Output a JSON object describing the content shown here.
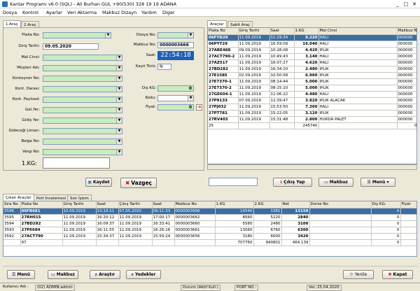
{
  "window": {
    "title": "Kantar Programı v6.0 (SQL) - Ali Burhan GUL  +90(530) 328 19 19  ADANA",
    "min": "_",
    "max": "□",
    "close": "✕"
  },
  "menu": [
    "Dosya",
    "Kontrol",
    "Ayarlar",
    "Veri Aktarma",
    "Makbuz Dizayn",
    "Yardım",
    "Diger"
  ],
  "left_tabs": [
    "1.Araç",
    "2.Araç"
  ],
  "form": {
    "plaka_label": "Plaka No:",
    "giris_tarihi_label": "Giriş Tarihi:",
    "giris_tarihi": "09.05.2020",
    "mal_cinsi_label": "Mal Cinsi:",
    "musteri_label": "Müşteri Adı:",
    "konteyner_label": "Konteyner No:",
    "kont_dara_label": "Kont. Darası:",
    "kont_payload_label": "Kont. Payload:",
    "gel_yer_label": "Gel.Yer:",
    "gidis_yer_label": "Gidiş Yer:",
    "gidecegi_liman_label": "Gideceği Liman:",
    "belge_label": "Belge No:",
    "vergi_label": "Vergi No:",
    "kg_label": "1.KG:",
    "dosya_label": "Dosya No:",
    "makbuz_label": "Makbuz No:",
    "makbuz_no": "0000003666",
    "saat_label": "Saat:",
    "saat": "22:54:18",
    "kayit_turu_label": "Kayıt Türü:",
    "kayit_turu": "N",
    "dis_kg_label": "Dış KG:",
    "dis_kg": "0",
    "kodu_label": "Kodu:",
    "fiyat_label": "Fiyat:",
    "fiyat": "0"
  },
  "right_tabs": [
    "Araçlar",
    "Sabit Araç"
  ],
  "vehicles": {
    "headers": [
      "Plaka No",
      "Giriş Tarihi",
      "Saat",
      "1.KG",
      "Mal Cinsi",
      "Makbuz No"
    ],
    "rows": [
      [
        "06FYD29",
        "11.09.2019",
        "11:29:34",
        "9.220",
        "HALI",
        "000000"
      ],
      [
        "06PYT29",
        "11.09.2019",
        "16:59:09",
        "16.040",
        "HALI",
        "000000"
      ],
      [
        "27ABE488",
        "09.09.2019",
        "10:28:08",
        "4.420",
        "IPLIK",
        "000000"
      ],
      [
        "27ACT790-2",
        "11.09.2019",
        "10:49:43",
        "3.140",
        "HALI",
        "000000"
      ],
      [
        "27AZ517",
        "11.09.2019",
        "16:07:27",
        "4.620",
        "HALI",
        "000000"
      ],
      [
        "27BD282",
        "11.09.2019",
        "16:34:10",
        "2.480",
        "IPLIK",
        "000000"
      ],
      [
        "27E1585",
        "02.09.2019",
        "10:50:58",
        "6.960",
        "IPLIK",
        "000000"
      ],
      [
        "27E7370-1",
        "11.09.2019",
        "08:14:44",
        "5.000",
        "IPLIK",
        "000000"
      ],
      [
        "27E7370-2",
        "11.09.2019",
        "08:15:10",
        "5.000",
        "IPLIK",
        "000000"
      ],
      [
        "27GE604-1",
        "11.09.2019",
        "11:06:22",
        "4.480",
        "HALI",
        "000000"
      ],
      [
        "27P9133",
        "07.09.2019",
        "12:39:47",
        "3.820",
        "IPLIK ALACAK",
        "000000"
      ],
      [
        "27PJ032",
        "11.09.2019",
        "15:53:50",
        "7.360",
        "HALI",
        "000000"
      ],
      [
        "27PT781",
        "11.09.2019",
        "15:22:05",
        "3.120",
        "IPLIK",
        "000000"
      ],
      [
        "27RV403",
        "11.09.2019",
        "15:31:48",
        "2.800",
        "HURDA PALET",
        "000000"
      ]
    ],
    "footer_count": "25",
    "footer_sum": "245740",
    "footer_end": "0"
  },
  "buttons": {
    "kaydet": "Kaydet",
    "vazgec": "Vazgeç",
    "cikis_yap": "Çıkış Yap",
    "makbuz": "Makbuz",
    "menu": "Menü"
  },
  "bottom_tabs": [
    "Çıkan Araçlar",
    "Port İncelemesi",
    "Son İşlem"
  ],
  "exits": {
    "headers": [
      "Sıra No",
      "Plaka No",
      "Giriş Tarihi",
      "Saat",
      "Çıkış Tarihi",
      "Saat",
      "Makbuz No",
      "1.KG",
      "2.KG",
      "Net",
      "Dorse No",
      "Dış KG:",
      "Fiyat"
    ],
    "rows": [
      [
        "3598",
        "06FB681",
        "10.09.2019",
        "13:19:11",
        "07.05.2020",
        "09:11:33",
        "0000003996",
        "14540",
        "1381",
        "13159",
        "",
        "0",
        ""
      ],
      [
        "3595",
        "27RH015",
        "11.09.2019",
        "16:20:12",
        "11.09.2019",
        "17:00:17",
        "0000003662",
        "8060",
        "5220",
        "2840",
        "",
        "0",
        ""
      ],
      [
        "3594",
        "27BD282",
        "11.09.2019",
        "16:09:37",
        "11.09.2019",
        "16:33:41",
        "0000003660",
        "5580",
        "2480",
        "3100",
        "",
        "0",
        ""
      ],
      [
        "3593",
        "27P6684",
        "11.09.2019",
        "16:11:55",
        "11.09.2019",
        "16:26:16",
        "0000003661",
        "13060",
        "6760",
        "6300",
        "",
        "0",
        ""
      ],
      [
        "3592",
        "27ACT790",
        "11.09.2019",
        "15:34:37",
        "11.09.2019",
        "15:59:24",
        "0000003656",
        "3180",
        "6600",
        "3420",
        "",
        "0",
        ""
      ]
    ],
    "footer_count": "97",
    "footer_kg1": "707760",
    "footer_kg2": "940801",
    "footer_net": "464.139",
    "footer_end": "0"
  },
  "bottom_buttons": {
    "menu": "Menü",
    "makbuz": "Makbuz",
    "arastir": "Araştır",
    "yedekler": "Yedekler",
    "yenile": "Yenile",
    "kapat": "Kapat"
  },
  "status": {
    "user": "Kullanıcı Adı :",
    "user_val": "(02) ADMIN-admin",
    "durum": "Durum (Aktif Kull.)",
    "port": "PORT NO :",
    "ver": "Ver.:25.04.2020"
  },
  "colors": {
    "accent": "#3a6ea5",
    "field_green": "#c9ecc0",
    "clock_bg": "#1f5fb5"
  }
}
